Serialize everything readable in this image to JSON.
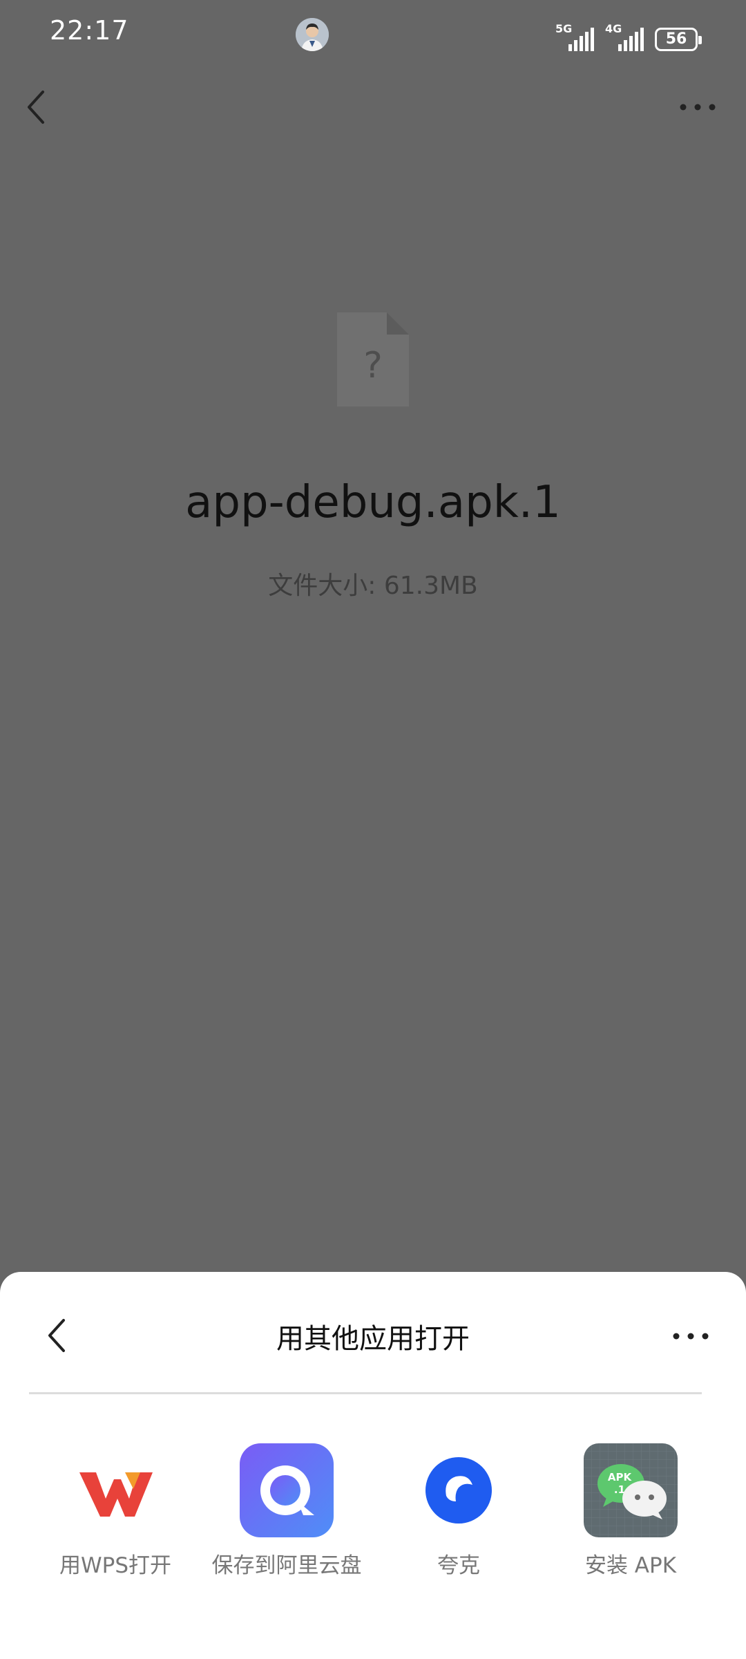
{
  "status_bar": {
    "time": "22:17",
    "network_1": "5G",
    "network_2": "4G",
    "battery": "56"
  },
  "file": {
    "name": "app-debug.apk.1",
    "size_text": "文件大小: 61.3MB",
    "placeholder_glyph": "?"
  },
  "sheet": {
    "title": "用其他应用打开",
    "apps": [
      {
        "label": "用WPS打开",
        "icon": "wps-icon"
      },
      {
        "label": "保存到阿里云盘",
        "icon": "aliyun-drive-icon"
      },
      {
        "label": "夸克",
        "icon": "quark-icon"
      },
      {
        "label": "安装 APK",
        "icon": "install-apk-icon"
      }
    ]
  },
  "install_icon_badge": {
    "line1": "APK",
    "line2": ".1"
  },
  "colors": {
    "overlay": "#666666",
    "wps_red": "#e8423a",
    "aliyun_blue": "#5a6ff0",
    "quark_blue": "#1f5cf0",
    "apk_bg": "#5f6b70",
    "apk_green": "#5dc86e"
  }
}
